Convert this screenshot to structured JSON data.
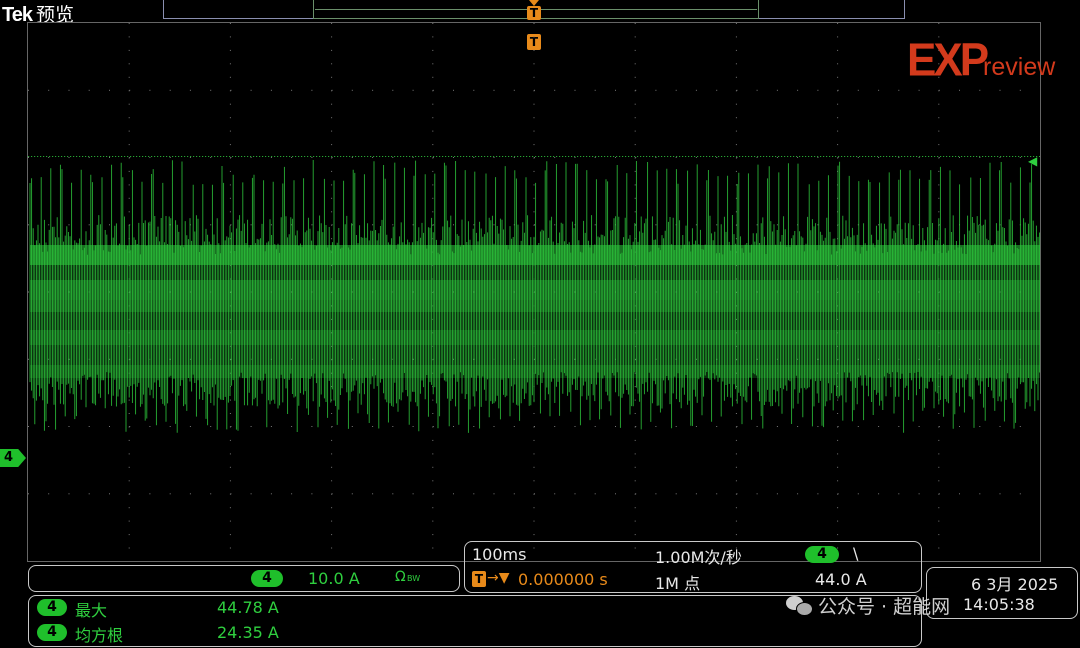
{
  "header": {
    "brand": "Tek",
    "mode": "预览"
  },
  "trigger_marker": "T",
  "channel_marker": "4",
  "logo": {
    "brand": "EXP",
    "suffix": "review"
  },
  "channel_panel": {
    "channel": "4",
    "scale": "10.0 A",
    "coupling": "Ω",
    "bw": "BW"
  },
  "timebase_panel": {
    "time_per_div": "100ms",
    "sample_rate": "1.00M次/秒",
    "trigger_channel": "4",
    "trigger_slope": "\\",
    "trigger_position": "0.000000 s",
    "record_length": "1M 点",
    "trigger_level": "44.0 A"
  },
  "datetime": {
    "date": "6 3月 2025",
    "time": "14:05:38"
  },
  "measurements": [
    {
      "channel": "4",
      "label": "最大",
      "value": "44.78 A"
    },
    {
      "channel": "4",
      "label": "均方根",
      "value": "24.35 A"
    }
  ],
  "watermark": {
    "text": "公众号 · 超能网"
  },
  "colors": {
    "trace": "#2fcf3f",
    "trigger": "#e88a1a",
    "logo": "#d33a1c",
    "graticule": "#666666"
  }
}
